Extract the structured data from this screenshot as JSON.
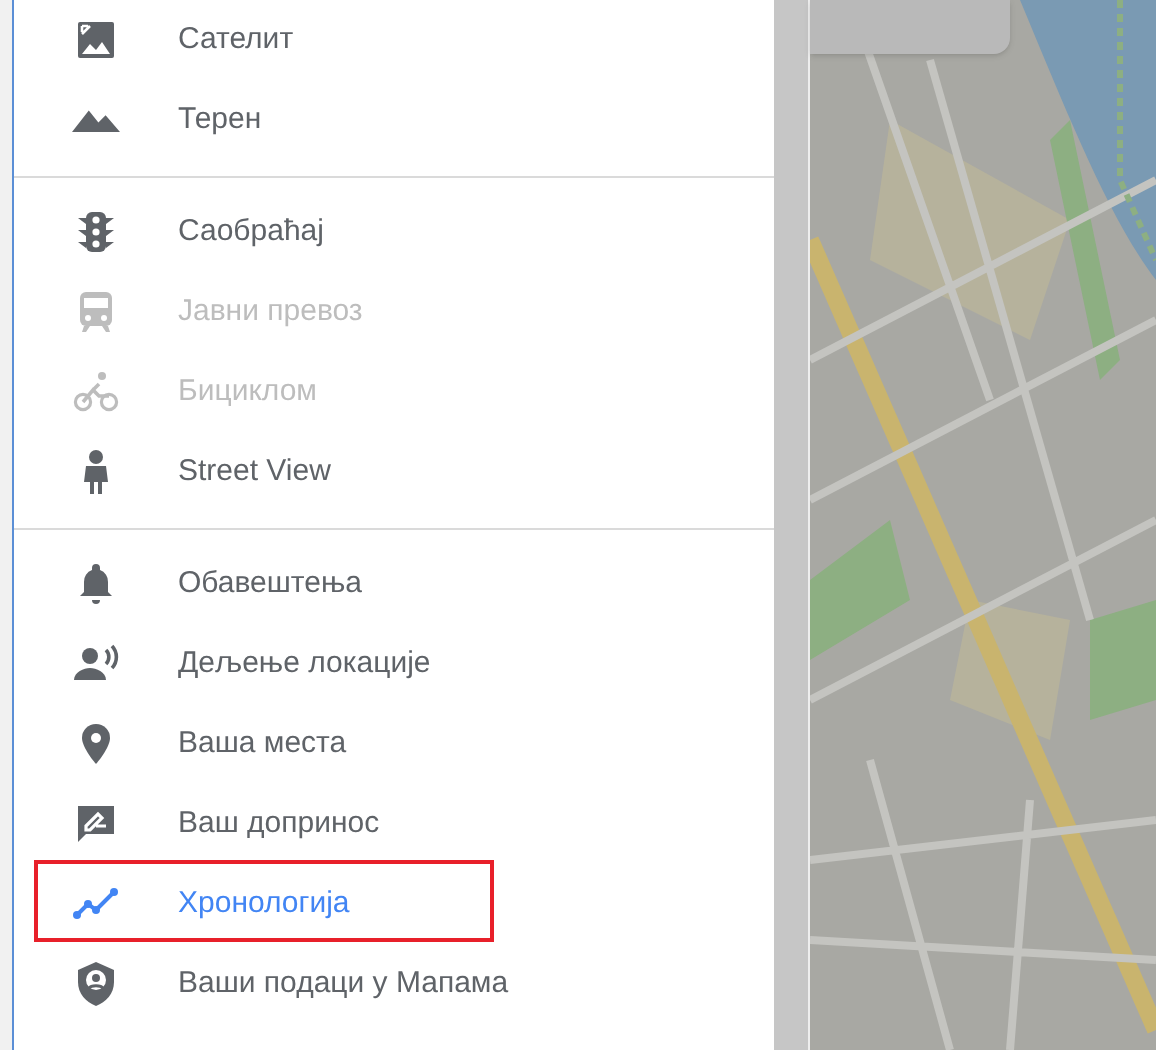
{
  "menu": {
    "groups": [
      {
        "items": [
          {
            "label": "Сателит",
            "disabled": false,
            "highlighted": false
          },
          {
            "label": "Терен",
            "disabled": false,
            "highlighted": false
          }
        ]
      },
      {
        "items": [
          {
            "label": "Саобраћај",
            "disabled": false,
            "highlighted": false
          },
          {
            "label": "Јавни превоз",
            "disabled": true,
            "highlighted": false
          },
          {
            "label": "Бициклом",
            "disabled": true,
            "highlighted": false
          },
          {
            "label": "Street View",
            "disabled": false,
            "highlighted": false
          }
        ]
      },
      {
        "items": [
          {
            "label": "Обавештења",
            "disabled": false,
            "highlighted": false
          },
          {
            "label": "Дељење локације",
            "disabled": false,
            "highlighted": false
          },
          {
            "label": "Ваша места",
            "disabled": false,
            "highlighted": false
          },
          {
            "label": "Ваш допринос",
            "disabled": false,
            "highlighted": false
          },
          {
            "label": "Хронологија",
            "disabled": false,
            "highlighted": true
          },
          {
            "label": "Ваши подаци у Мапама",
            "disabled": false,
            "highlighted": false
          }
        ]
      }
    ]
  }
}
